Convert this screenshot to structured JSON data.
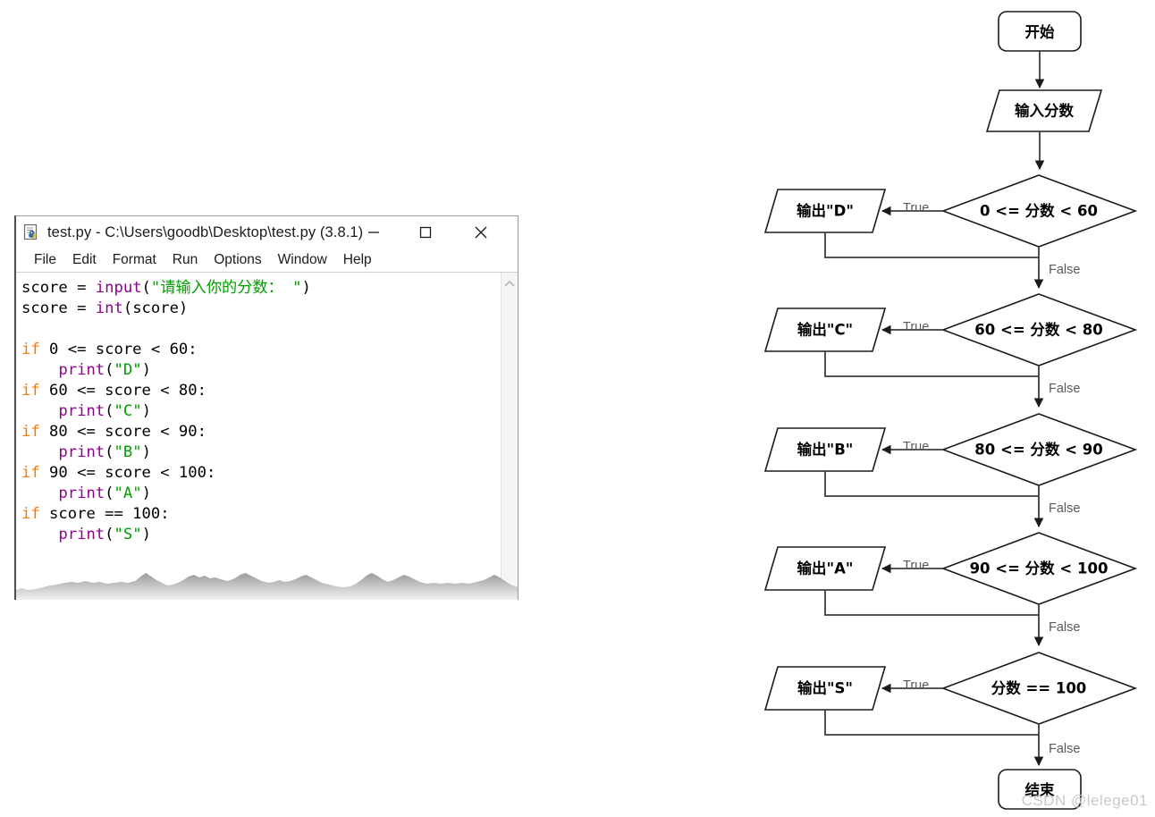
{
  "window": {
    "title": "test.py - C:\\Users\\goodb\\Desktop\\test.py (3.8.1)",
    "icon": "python-idle-icon",
    "controls": {
      "minimize": "—",
      "maximize": "□",
      "close": "✕"
    },
    "menu": [
      "File",
      "Edit",
      "Format",
      "Run",
      "Options",
      "Window",
      "Help"
    ],
    "scrollbar": {
      "up_arrow": "ⱏ"
    }
  },
  "code": {
    "lines": [
      [
        {
          "t": "score = ",
          "c": "plain"
        },
        {
          "t": "input",
          "c": "bi"
        },
        {
          "t": "(",
          "c": "plain"
        },
        {
          "t": "\"请输入你的分数： \"",
          "c": "str"
        },
        {
          "t": ")",
          "c": "plain"
        }
      ],
      [
        {
          "t": "score = ",
          "c": "plain"
        },
        {
          "t": "int",
          "c": "bi"
        },
        {
          "t": "(score)",
          "c": "plain"
        }
      ],
      [],
      [
        {
          "t": "if",
          "c": "kw"
        },
        {
          "t": " 0 <= score < 60:",
          "c": "plain"
        }
      ],
      [
        {
          "t": "    ",
          "c": "plain"
        },
        {
          "t": "print",
          "c": "bi"
        },
        {
          "t": "(",
          "c": "plain"
        },
        {
          "t": "\"D\"",
          "c": "str"
        },
        {
          "t": ")",
          "c": "plain"
        }
      ],
      [
        {
          "t": "if",
          "c": "kw"
        },
        {
          "t": " 60 <= score < 80:",
          "c": "plain"
        }
      ],
      [
        {
          "t": "    ",
          "c": "plain"
        },
        {
          "t": "print",
          "c": "bi"
        },
        {
          "t": "(",
          "c": "plain"
        },
        {
          "t": "\"C\"",
          "c": "str"
        },
        {
          "t": ")",
          "c": "plain"
        }
      ],
      [
        {
          "t": "if",
          "c": "kw"
        },
        {
          "t": " 80 <= score < 90:",
          "c": "plain"
        }
      ],
      [
        {
          "t": "    ",
          "c": "plain"
        },
        {
          "t": "print",
          "c": "bi"
        },
        {
          "t": "(",
          "c": "plain"
        },
        {
          "t": "\"B\"",
          "c": "str"
        },
        {
          "t": ")",
          "c": "plain"
        }
      ],
      [
        {
          "t": "if",
          "c": "kw"
        },
        {
          "t": " 90 <= score < 100:",
          "c": "plain"
        }
      ],
      [
        {
          "t": "    ",
          "c": "plain"
        },
        {
          "t": "print",
          "c": "bi"
        },
        {
          "t": "(",
          "c": "plain"
        },
        {
          "t": "\"A\"",
          "c": "str"
        },
        {
          "t": ")",
          "c": "plain"
        }
      ],
      [
        {
          "t": "if",
          "c": "kw"
        },
        {
          "t": " score == 100:",
          "c": "plain"
        }
      ],
      [
        {
          "t": "    ",
          "c": "plain"
        },
        {
          "t": "print",
          "c": "bi"
        },
        {
          "t": "(",
          "c": "plain"
        },
        {
          "t": "\"S\"",
          "c": "str"
        },
        {
          "t": ")",
          "c": "plain"
        }
      ]
    ]
  },
  "flowchart": {
    "start_label": "开始",
    "input_label": "输入分数",
    "end_label": "结束",
    "true_label": "True",
    "false_label": "False",
    "rows": [
      {
        "condition": "0 <= 分数 < 60",
        "output": "输出\"D\""
      },
      {
        "condition": "60 <= 分数 < 80",
        "output": "输出\"C\""
      },
      {
        "condition": "80 <= 分数 < 90",
        "output": "输出\"B\""
      },
      {
        "condition": "90 <= 分数 < 100",
        "output": "输出\"A\""
      },
      {
        "condition": "分数 == 100",
        "output": "输出\"S\""
      }
    ]
  },
  "watermark": "CSDN @lelege01",
  "colors": {
    "keyword": "#ff7700",
    "builtin": "#900090",
    "string": "#00a000",
    "shape_stroke": "#1b1b1b",
    "edge_label": "#5a5a5a",
    "watermark": "#c9c9c9"
  }
}
